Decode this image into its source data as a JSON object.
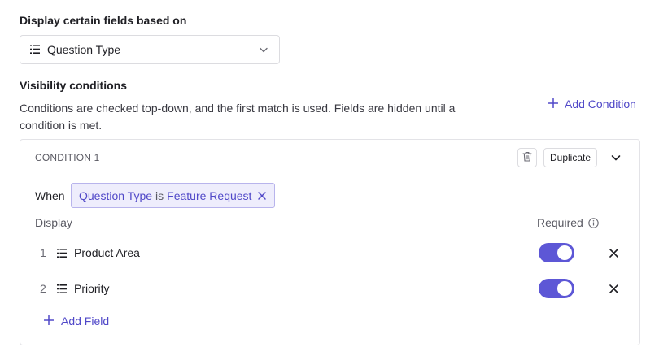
{
  "display_section": {
    "label": "Display certain fields based on",
    "select_value": "Question Type",
    "select_icon": "list-icon"
  },
  "visibility": {
    "label": "Visibility conditions",
    "description": "Conditions are checked top-down, and the first match is used. Fields are hidden until a condition is met.",
    "add_condition_label": "Add Condition"
  },
  "condition": {
    "title": "CONDITION 1",
    "duplicate_label": "Duplicate",
    "when_label": "When",
    "filter": {
      "field": "Question Type",
      "operator": "is",
      "value": "Feature Request"
    },
    "display_header": "Display",
    "required_header": "Required",
    "fields": [
      {
        "index": "1",
        "name": "Product Area",
        "required": true
      },
      {
        "index": "2",
        "name": "Priority",
        "required": true
      }
    ],
    "add_field_label": "Add Field"
  },
  "colors": {
    "accent": "#5048c8",
    "toggle_on": "#5d57d6",
    "chip_bg": "#eeedfc",
    "chip_border": "#b8b4ec"
  }
}
